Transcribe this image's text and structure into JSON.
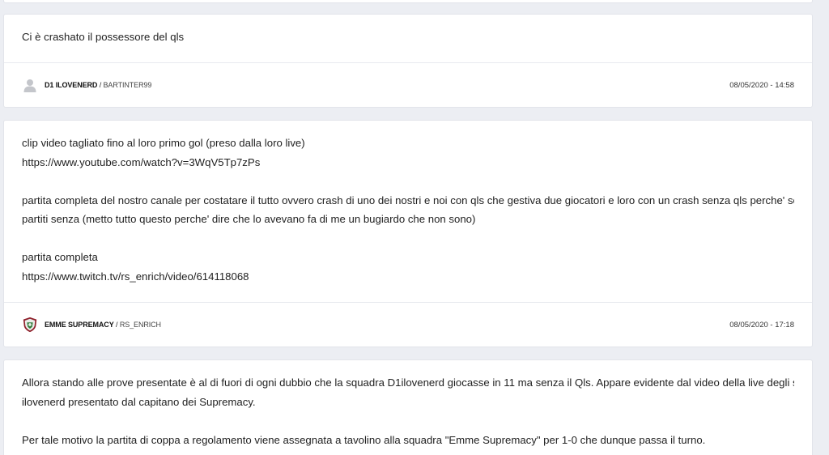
{
  "posts": [
    {
      "paragraphs": [
        "Ci è crashato il possessore del qls"
      ],
      "author": {
        "team": "D1 ILOVENERD",
        "separator": "/",
        "user": "BARTINTER99"
      },
      "date": "08/05/2020 - 14:58"
    },
    {
      "paragraphs": [
        "clip video tagliato fino al loro primo gol (preso dalla loro live)",
        "https://www.youtube.com/watch?v=3WqV5Tp7zPs",
        "partita completa del nostro canale per costatare il tutto ovvero crash di uno dei nostri e noi con qls che gestiva due giocatori e loro con un crash senza qls perche' sono",
        "partiti senza (metto tutto questo perche' dire che lo avevano fa di me un bugiardo che non sono)",
        "partita completa",
        "https://www.twitch.tv/rs_enrich/video/614118068"
      ],
      "author": {
        "team": "EMME SUPREMACY",
        "separator": "/",
        "user": "RS_ENRICH"
      },
      "date": "08/05/2020 - 17:18"
    },
    {
      "paragraphs": [
        "Allora stando alle prove presentate è al di fuori di ogni dubbio che la squadra D1ilovenerd giocasse in 11 ma senza il Qls. Appare evidente dal video della live degli stessi",
        "ilovenerd presentato dal capitano dei Supremacy.",
        "Per tale motivo la partita di coppa a regolamento viene assegnata a tavolino alla squadra \"Emme Supremacy\" per 1-0 che dunque passa il turno."
      ]
    }
  ],
  "icons": {
    "default_avatar": "person-silhouette-icon",
    "team_logo": "emme-supremacy-shield-icon"
  },
  "colors": {
    "background": "#eceef3",
    "card": "#ffffff",
    "text": "#222222"
  }
}
